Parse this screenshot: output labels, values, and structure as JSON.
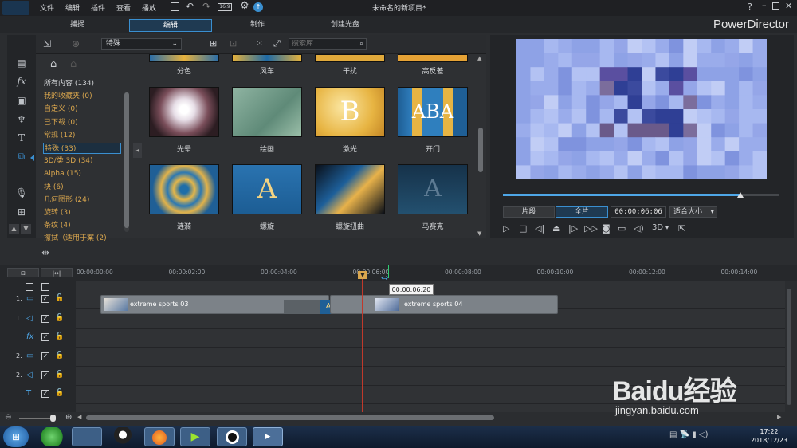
{
  "app": {
    "title": "未命名的新项目*",
    "brand": "PowerDirector"
  },
  "menu": [
    "文件",
    "编辑",
    "插件",
    "查看",
    "播放"
  ],
  "tabs": [
    "捕捉",
    "编辑",
    "制作",
    "创建光盘"
  ],
  "library": {
    "filter_value": "特殊",
    "search_placeholder": "搜索库",
    "categories": [
      {
        "label": "所有内容 (134)",
        "style": "white"
      },
      {
        "label": "我的收藏夹 (0)",
        "style": "gold"
      },
      {
        "label": "自定义 (0)",
        "style": "gold"
      },
      {
        "label": "已下载 (0)",
        "style": "gold"
      },
      {
        "label": "常规 (12)",
        "style": "gold"
      },
      {
        "label": "特殊 (33)",
        "style": "gold",
        "selected": true
      },
      {
        "label": "3D/类 3D (34)",
        "style": "gold"
      },
      {
        "label": "Alpha (15)",
        "style": "gold"
      },
      {
        "label": "块 (6)",
        "style": "gold"
      },
      {
        "label": "几何图形 (24)",
        "style": "gold"
      },
      {
        "label": "旋转 (3)",
        "style": "gold"
      },
      {
        "label": "条纹 (4)",
        "style": "gold"
      },
      {
        "label": "擦拭（适用于案 (2)",
        "style": "gold"
      }
    ],
    "row1_labels": [
      "分色",
      "风车",
      "干扰",
      "高反差"
    ],
    "row2_labels": [
      "光晕",
      "绘画",
      "激光",
      "开门"
    ],
    "row3_labels": [
      "涟漪",
      "螺旋",
      "螺旋扭曲",
      "马赛克"
    ]
  },
  "preview": {
    "mode_clip": "片段",
    "mode_full": "全片",
    "timecode": "00:00:06:06",
    "fit": "适合大小",
    "threed": "3D",
    "progress": 0.86
  },
  "timeline": {
    "ticks": [
      "00:00:00:00",
      "00:00:02:00",
      "00:00:04:00",
      "00:00:06:00",
      "00:00:08:00",
      "00:00:10:00",
      "00:00:12:00",
      "00:00:14:00"
    ],
    "tooltip": "00:00:06:20",
    "clip1": "extreme sports 03",
    "clip2": "extreme sports 04",
    "tracks": [
      "1.",
      "1.",
      "",
      "2.",
      "2.",
      "",
      ""
    ]
  },
  "taskbar": {
    "time": "17:22",
    "date": "2018/12/23"
  },
  "watermark": {
    "line1": "Baidu经验",
    "line2": "jingyan.baidu.com"
  },
  "colors": {
    "accent": "#3a8fd0",
    "gold": "#d9a64e",
    "playhead": "#c0392b"
  }
}
